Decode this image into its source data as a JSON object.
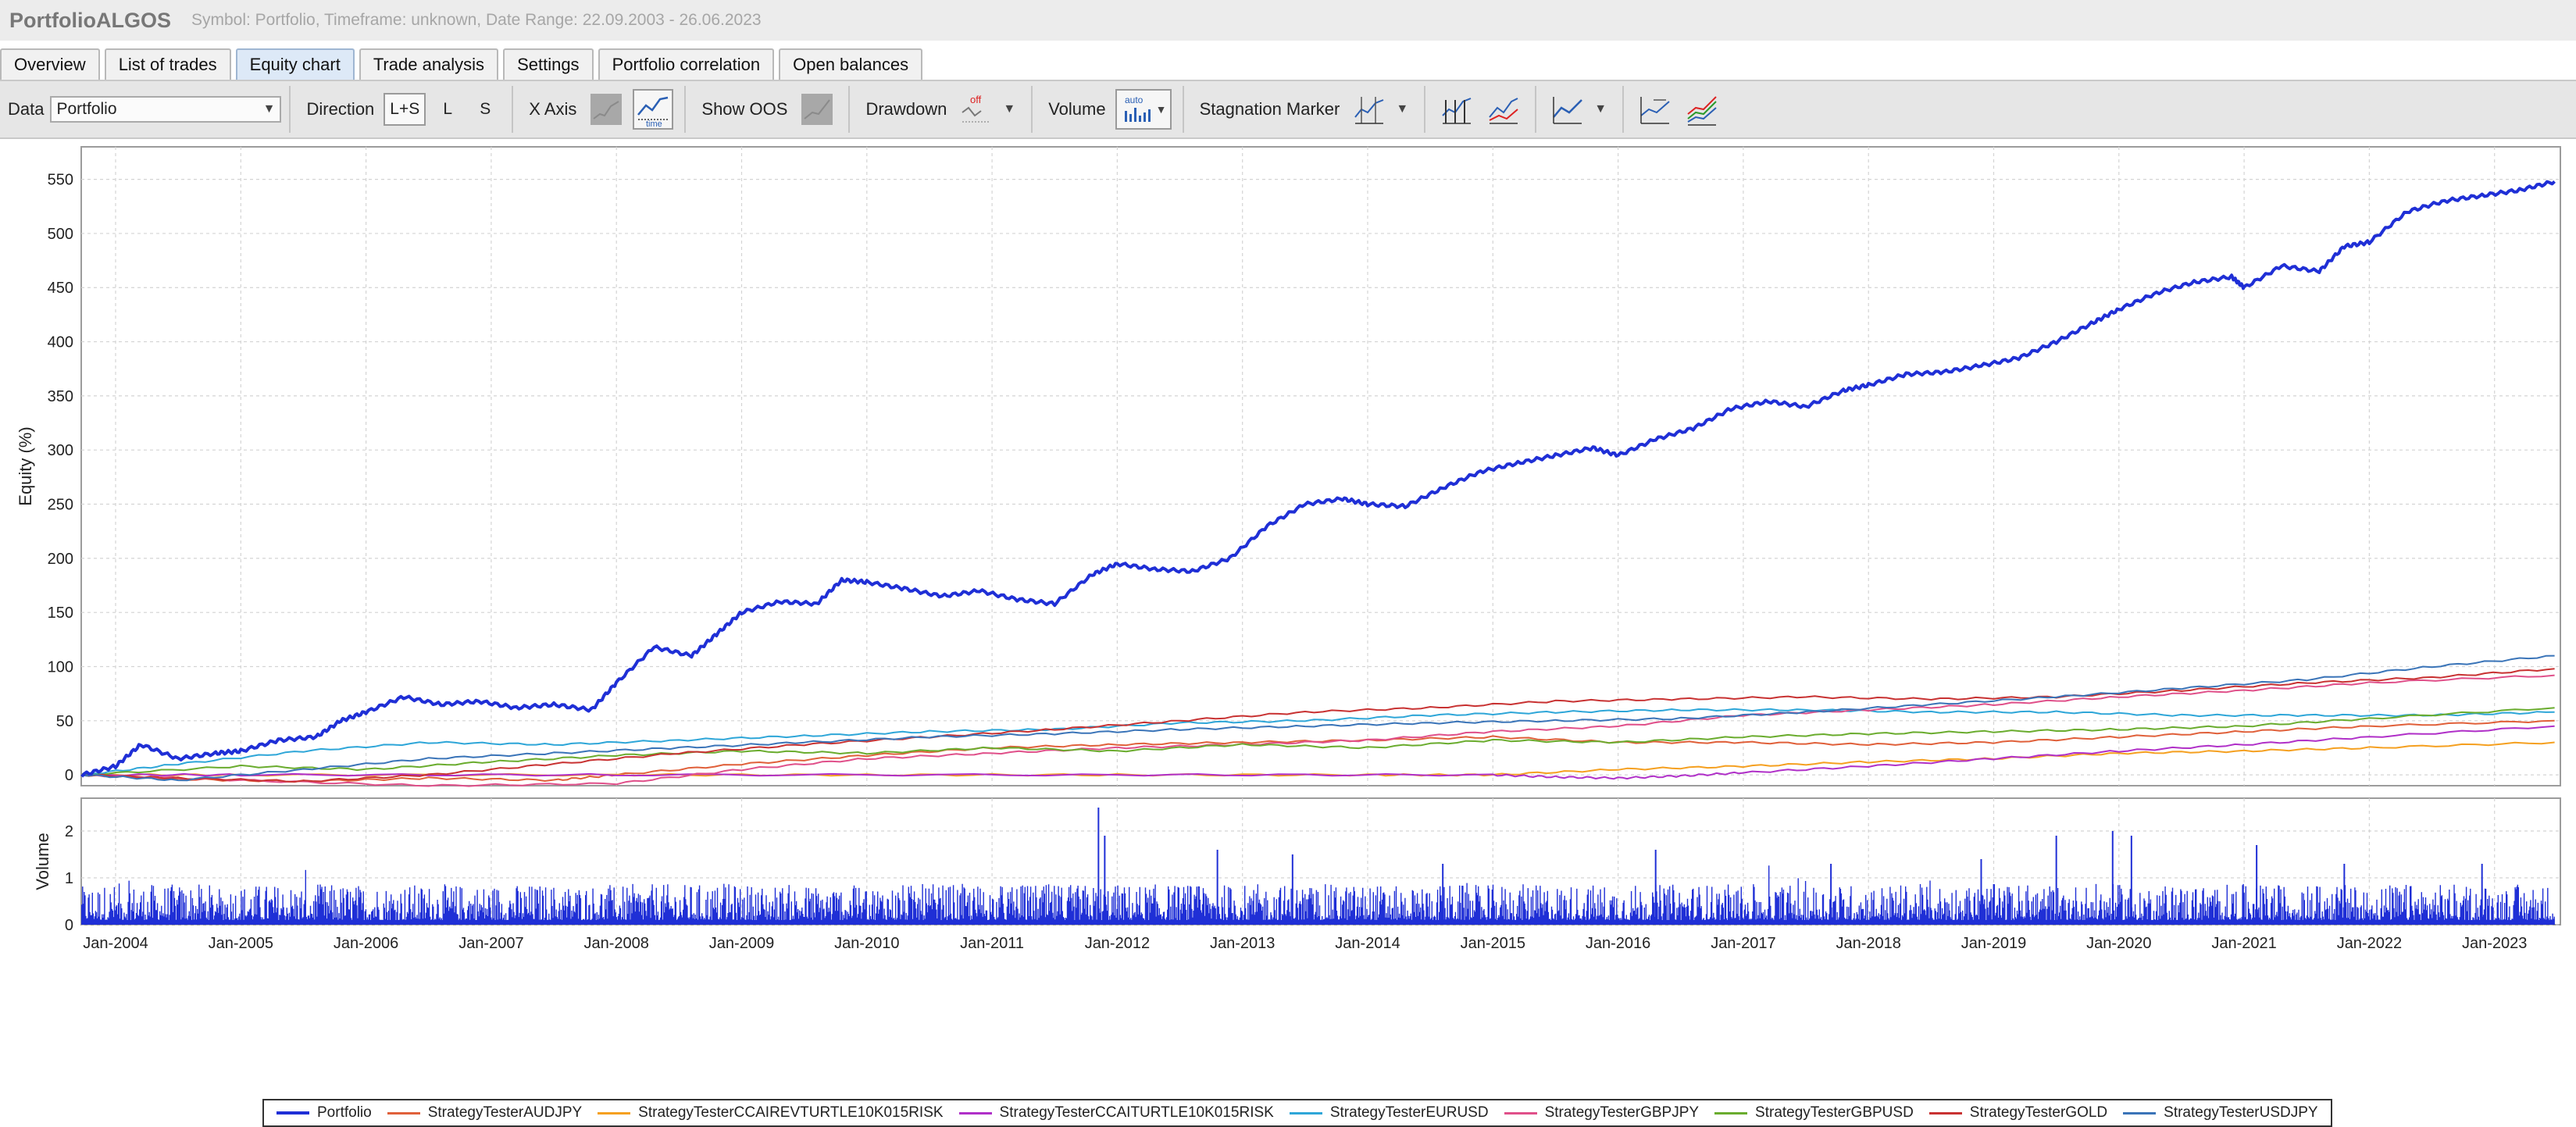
{
  "app": {
    "title": "PortfolioALGOS",
    "subtitle": "Symbol: Portfolio, Timeframe: unknown, Date Range: 22.09.2003 - 26.06.2023"
  },
  "tabs": [
    {
      "label": "Overview",
      "active": false
    },
    {
      "label": "List of trades",
      "active": false
    },
    {
      "label": "Equity chart",
      "active": true
    },
    {
      "label": "Trade analysis",
      "active": false
    },
    {
      "label": "Settings",
      "active": false
    },
    {
      "label": "Portfolio correlation",
      "active": false
    },
    {
      "label": "Open balances",
      "active": false
    }
  ],
  "toolbar": {
    "data_label": "Data",
    "data_value": "Portfolio",
    "direction_label": "Direction",
    "direction_options": [
      "L+S",
      "L",
      "S"
    ],
    "direction_selected": "L+S",
    "xaxis_label": "X Axis",
    "xaxis_icons": [
      "trades-axis-icon",
      "time-axis-icon"
    ],
    "xaxis_time_text": "time",
    "show_oos_label": "Show OOS",
    "drawdown_label": "Drawdown",
    "drawdown_state": "off",
    "volume_label": "Volume",
    "volume_state": "auto",
    "stagnation_label": "Stagnation Marker"
  },
  "colors": {
    "portfolio": "#1f2fd6",
    "volume": "#1f2fd6",
    "grid": "#d4d4d4"
  },
  "chart_data": [
    {
      "type": "line",
      "ylabel": "Equity (%)",
      "ylim": [
        -10,
        580
      ],
      "yticks": [
        0,
        50,
        100,
        150,
        200,
        250,
        300,
        350,
        400,
        450,
        500,
        550
      ],
      "grid": true,
      "legend_position": "bottom",
      "series": [
        {
          "name": "Portfolio",
          "color": "#1f2fd6",
          "width": 4,
          "x": [
            2003.73,
            2004.0,
            2004.2,
            2004.5,
            2004.8,
            2005.0,
            2005.3,
            2005.6,
            2005.8,
            2006.0,
            2006.3,
            2006.6,
            2006.9,
            2007.2,
            2007.5,
            2007.8,
            2008.0,
            2008.3,
            2008.6,
            2008.8,
            2009.0,
            2009.3,
            2009.6,
            2009.8,
            2010.0,
            2010.3,
            2010.6,
            2010.9,
            2011.2,
            2011.5,
            2011.8,
            2012.0,
            2012.3,
            2012.6,
            2012.9,
            2013.2,
            2013.5,
            2013.8,
            2014.0,
            2014.3,
            2014.6,
            2014.9,
            2015.2,
            2015.5,
            2015.8,
            2016.0,
            2016.3,
            2016.6,
            2016.9,
            2017.2,
            2017.5,
            2017.8,
            2018.0,
            2018.3,
            2018.6,
            2018.9,
            2019.2,
            2019.5,
            2019.8,
            2020.0,
            2020.3,
            2020.6,
            2020.9,
            2021.0,
            2021.3,
            2021.6,
            2021.8,
            2022.0,
            2022.3,
            2022.6,
            2022.9,
            2023.2,
            2023.48
          ],
          "values": [
            0,
            8,
            28,
            15,
            20,
            22,
            32,
            35,
            50,
            58,
            72,
            65,
            68,
            62,
            65,
            60,
            85,
            118,
            110,
            130,
            150,
            160,
            158,
            180,
            178,
            172,
            165,
            170,
            162,
            158,
            185,
            195,
            190,
            188,
            200,
            230,
            250,
            255,
            250,
            248,
            265,
            280,
            288,
            295,
            302,
            295,
            310,
            320,
            338,
            345,
            340,
            355,
            360,
            370,
            372,
            378,
            385,
            400,
            418,
            430,
            445,
            455,
            460,
            450,
            470,
            465,
            488,
            492,
            520,
            530,
            535,
            540,
            548
          ]
        },
        {
          "name": "StrategyTesterAUDJPY",
          "color": "#e0603a",
          "width": 2,
          "x": [
            2003.73,
            2004.5,
            2005.5,
            2006.5,
            2007.5,
            2008.0,
            2009.0,
            2010.0,
            2011.0,
            2012.0,
            2013.0,
            2014.0,
            2015.0,
            2016.0,
            2017.0,
            2018.0,
            2019.0,
            2020.0,
            2021.0,
            2022.0,
            2023.48
          ],
          "values": [
            0,
            -4,
            -6,
            -3,
            -5,
            0,
            10,
            18,
            25,
            28,
            30,
            32,
            35,
            30,
            30,
            28,
            30,
            35,
            40,
            45,
            50
          ]
        },
        {
          "name": "StrategyTesterCCAIREVTURTLE10K015RISK",
          "color": "#f5a020",
          "width": 2,
          "x": [
            2003.73,
            2005.0,
            2008.0,
            2010.0,
            2012.0,
            2014.0,
            2015.0,
            2016.0,
            2017.0,
            2018.0,
            2019.0,
            2020.0,
            2021.0,
            2022.0,
            2023.48
          ],
          "values": [
            0,
            0,
            0,
            0,
            0,
            0,
            0,
            5,
            8,
            12,
            15,
            20,
            22,
            25,
            30
          ]
        },
        {
          "name": "StrategyTesterCCAITURTLE10K015RISK",
          "color": "#b030c8",
          "width": 2,
          "x": [
            2003.73,
            2005.0,
            2008.0,
            2012.0,
            2015.0,
            2015.5,
            2016.0,
            2016.5,
            2017.0,
            2018.0,
            2019.0,
            2020.0,
            2021.0,
            2022.0,
            2023.48
          ],
          "values": [
            0,
            0,
            0,
            0,
            0,
            -2,
            -3,
            -1,
            2,
            8,
            15,
            22,
            28,
            35,
            45
          ]
        },
        {
          "name": "StrategyTesterEURUSD",
          "color": "#2ea6d8",
          "width": 2,
          "x": [
            2003.73,
            2004.5,
            2005.5,
            2006.5,
            2007.5,
            2008.5,
            2009.5,
            2010.5,
            2011.5,
            2012.5,
            2013.5,
            2014.5,
            2015.5,
            2016.5,
            2017.5,
            2018.5,
            2019.5,
            2020.5,
            2021.5,
            2022.5,
            2023.48
          ],
          "values": [
            0,
            10,
            22,
            30,
            28,
            32,
            36,
            40,
            42,
            48,
            50,
            55,
            58,
            60,
            60,
            58,
            58,
            55,
            55,
            55,
            58
          ]
        },
        {
          "name": "StrategyTesterGBPJPY",
          "color": "#e0508a",
          "width": 2,
          "x": [
            2003.73,
            2005.0,
            2006.5,
            2008.0,
            2009.0,
            2010.0,
            2011.0,
            2012.0,
            2013.0,
            2014.0,
            2015.0,
            2016.0,
            2017.0,
            2018.0,
            2019.0,
            2020.0,
            2021.0,
            2022.0,
            2023.48
          ],
          "values": [
            0,
            -5,
            -10,
            -8,
            5,
            15,
            20,
            25,
            28,
            32,
            40,
            45,
            55,
            60,
            65,
            72,
            78,
            85,
            92
          ]
        },
        {
          "name": "StrategyTesterGBPUSD",
          "color": "#6aac2e",
          "width": 2,
          "x": [
            2003.73,
            2005.0,
            2006.0,
            2007.0,
            2008.0,
            2009.0,
            2010.0,
            2011.0,
            2012.0,
            2013.0,
            2014.0,
            2015.0,
            2016.0,
            2017.0,
            2018.0,
            2019.0,
            2020.0,
            2021.0,
            2022.0,
            2023.48
          ],
          "values": [
            0,
            8,
            5,
            12,
            18,
            22,
            20,
            25,
            22,
            28,
            25,
            32,
            30,
            35,
            38,
            40,
            42,
            45,
            52,
            62
          ]
        },
        {
          "name": "StrategyTesterGOLD",
          "color": "#c83232",
          "width": 2,
          "x": [
            2003.73,
            2004.5,
            2005.5,
            2006.5,
            2007.5,
            2008.5,
            2009.5,
            2010.5,
            2011.5,
            2012.5,
            2013.5,
            2014.5,
            2015.5,
            2016.5,
            2017.5,
            2018.5,
            2019.5,
            2020.5,
            2021.5,
            2022.5,
            2023.48
          ],
          "values": [
            0,
            -3,
            -6,
            0,
            10,
            20,
            28,
            35,
            42,
            50,
            58,
            62,
            68,
            70,
            72,
            70,
            72,
            78,
            85,
            90,
            98
          ]
        },
        {
          "name": "StrategyTesterUSDJPY",
          "color": "#3a74b8",
          "width": 2,
          "x": [
            2003.73,
            2004.5,
            2005.5,
            2006.5,
            2007.5,
            2008.5,
            2009.5,
            2010.5,
            2011.5,
            2012.5,
            2013.5,
            2014.5,
            2015.5,
            2016.5,
            2017.5,
            2018.5,
            2019.5,
            2020.5,
            2021.5,
            2022.5,
            2023.48
          ],
          "values": [
            0,
            -5,
            5,
            15,
            20,
            25,
            30,
            35,
            38,
            42,
            45,
            48,
            50,
            52,
            58,
            65,
            72,
            80,
            88,
            100,
            110
          ]
        }
      ]
    },
    {
      "type": "bar",
      "ylabel": "Volume",
      "ylim": [
        0,
        2.7
      ],
      "yticks": [
        0,
        1,
        2
      ],
      "grid": true,
      "x_range": [
        "Sep 2003",
        "Jun 2023"
      ],
      "x_tick_labels": [
        "Jan-2004",
        "Jan-2005",
        "Jan-2006",
        "Jan-2007",
        "Jan-2008",
        "Jan-2009",
        "Jan-2010",
        "Jan-2011",
        "Jan-2012",
        "Jan-2013",
        "Jan-2014",
        "Jan-2015",
        "Jan-2016",
        "Jan-2017",
        "Jan-2018",
        "Jan-2019",
        "Jan-2020",
        "Jan-2021",
        "Jan-2022",
        "Jan-2023"
      ],
      "typical_bar_range": [
        0.1,
        0.8
      ],
      "peaks": [
        {
          "x": 2011.85,
          "value": 2.5
        },
        {
          "x": 2011.9,
          "value": 1.9
        },
        {
          "x": 2019.95,
          "value": 2.0
        },
        {
          "x": 2020.1,
          "value": 1.9
        },
        {
          "x": 2012.8,
          "value": 1.6
        },
        {
          "x": 2016.3,
          "value": 1.6
        },
        {
          "x": 2018.9,
          "value": 1.4
        },
        {
          "x": 2021.1,
          "value": 1.7
        },
        {
          "x": 2022.9,
          "value": 1.3
        },
        {
          "x": 2014.6,
          "value": 1.3
        },
        {
          "x": 2017.7,
          "value": 1.3
        },
        {
          "x": 2019.5,
          "value": 1.9
        },
        {
          "x": 2021.8,
          "value": 1.3
        },
        {
          "x": 2013.4,
          "value": 1.5
        }
      ]
    }
  ]
}
